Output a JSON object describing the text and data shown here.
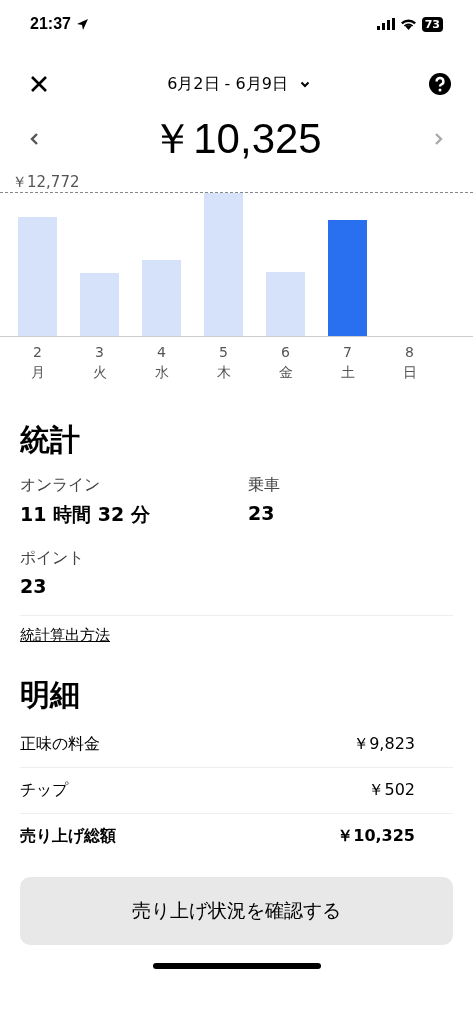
{
  "status_bar": {
    "time": "21:37",
    "battery": "73"
  },
  "header": {
    "date_range": "6月2日 - 6月9日"
  },
  "total": "￥10,325",
  "chart": {
    "reference_label": "￥12,772",
    "bars": [
      {
        "day": "2",
        "weekday": "月",
        "selected": false
      },
      {
        "day": "3",
        "weekday": "火",
        "selected": false
      },
      {
        "day": "4",
        "weekday": "水",
        "selected": false
      },
      {
        "day": "5",
        "weekday": "木",
        "selected": false
      },
      {
        "day": "6",
        "weekday": "金",
        "selected": false
      },
      {
        "day": "7",
        "weekday": "土",
        "selected": true
      },
      {
        "day": "8",
        "weekday": "日",
        "selected": false
      }
    ]
  },
  "stats": {
    "title": "統計",
    "items": [
      {
        "label": "オンライン",
        "value": "11 時間 32 分"
      },
      {
        "label": "乗車",
        "value": "23"
      },
      {
        "label": "ポイント",
        "value": "23"
      }
    ],
    "link": "統計算出方法"
  },
  "breakdown": {
    "title": "明細",
    "rows": [
      {
        "label": "正味の料金",
        "amount": "￥9,823",
        "total": false
      },
      {
        "label": "チップ",
        "amount": "￥502",
        "total": false
      },
      {
        "label": "売り上げ総額",
        "amount": "￥10,325",
        "total": true
      }
    ]
  },
  "button": "売り上げ状況を確認する"
}
